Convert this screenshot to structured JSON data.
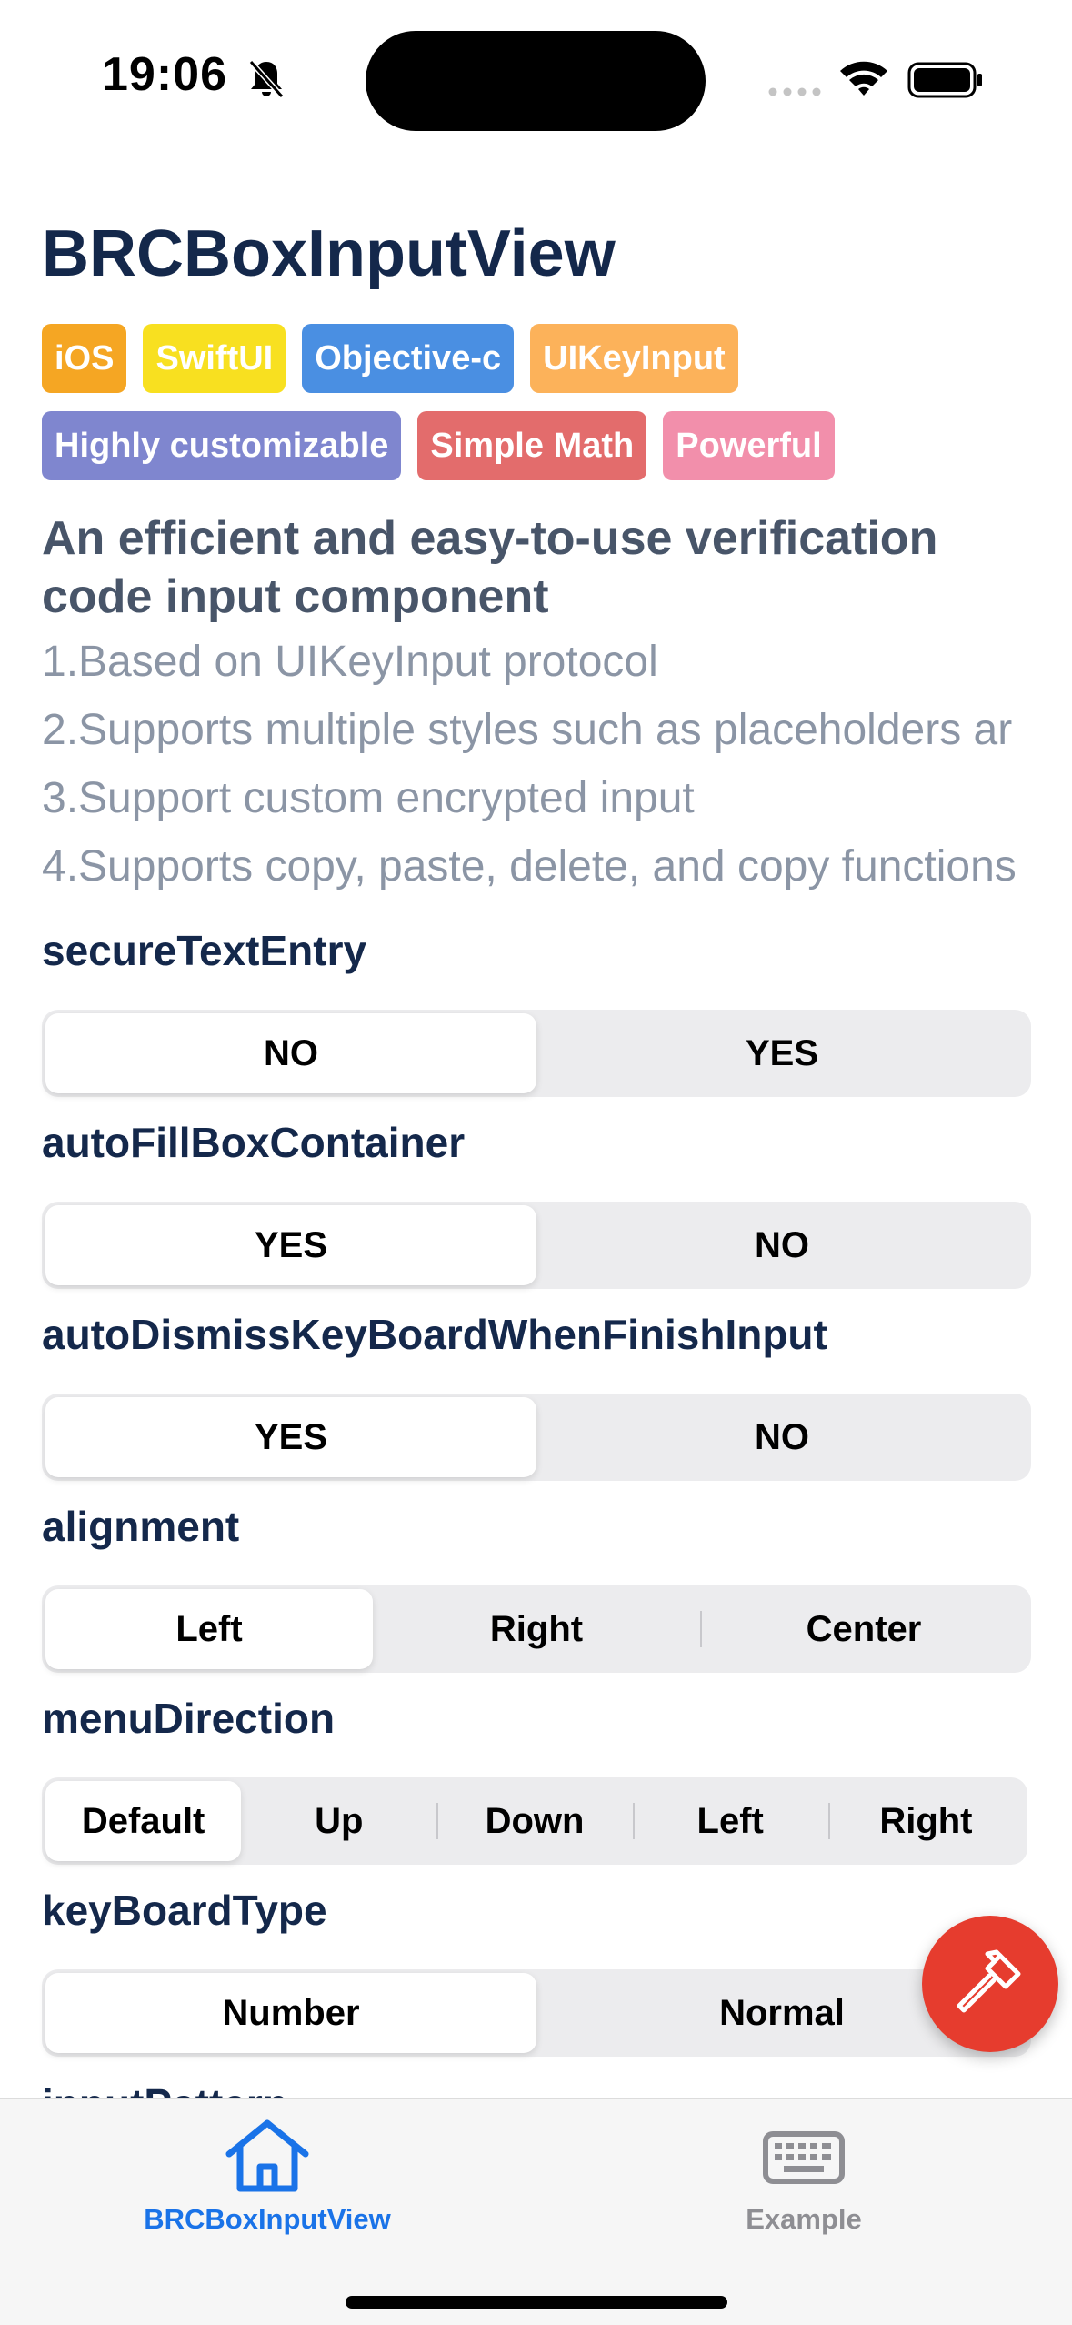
{
  "status_bar": {
    "time": "19:06",
    "icons": [
      "bell-slash-icon",
      "cellular-dots-icon",
      "wifi-icon",
      "battery-icon"
    ]
  },
  "header": {
    "title": "BRCBoxInputView"
  },
  "tags": [
    {
      "label": "iOS",
      "color": "#f5a623"
    },
    {
      "label": "SwiftUI",
      "color": "#f8e020"
    },
    {
      "label": "Objective-c",
      "color": "#4a8fe2"
    },
    {
      "label": "UIKeyInput",
      "color": "#fcb25a"
    },
    {
      "label": "Highly customizable",
      "color": "#7f86cf"
    },
    {
      "label": "Simple Math",
      "color": "#e36c6c"
    },
    {
      "label": "Powerful",
      "color": "#f28fab"
    }
  ],
  "description": {
    "subtitle": "An efficient and easy-to-use verification code input component",
    "features": [
      "1.Based on UIKeyInput protocol",
      "2.Supports multiple styles such as placeholders ar",
      "3.Support custom encrypted input",
      "4.Supports copy, paste, delete, and copy functions"
    ]
  },
  "options": [
    {
      "label": "secureTextEntry",
      "segments": [
        "NO",
        "YES"
      ],
      "selected": 0
    },
    {
      "label": "autoFillBoxContainer",
      "segments": [
        "YES",
        "NO"
      ],
      "selected": 0
    },
    {
      "label": "autoDismissKeyBoardWhenFinishInput",
      "segments": [
        "YES",
        "NO"
      ],
      "selected": 0
    },
    {
      "label": "alignment",
      "segments": [
        "Left",
        "Right",
        "Center"
      ],
      "selected": 0
    },
    {
      "label": "menuDirection",
      "segments": [
        "Default",
        "Up",
        "Down",
        "Left",
        "Right"
      ],
      "selected": 0
    },
    {
      "label": "keyBoardType",
      "segments": [
        "Number",
        "Normal"
      ],
      "selected": 0
    }
  ],
  "partially_visible_label": "inputPattern",
  "fab": {
    "icon": "hammer-icon",
    "color": "#e63c2e"
  },
  "tab_bar": {
    "tabs": [
      {
        "label": "BRCBoxInputView",
        "icon": "house-icon",
        "active": true,
        "color": "#1a73e8"
      },
      {
        "label": "Example",
        "icon": "keyboard-icon",
        "active": false,
        "color": "#8e8e93"
      }
    ]
  }
}
